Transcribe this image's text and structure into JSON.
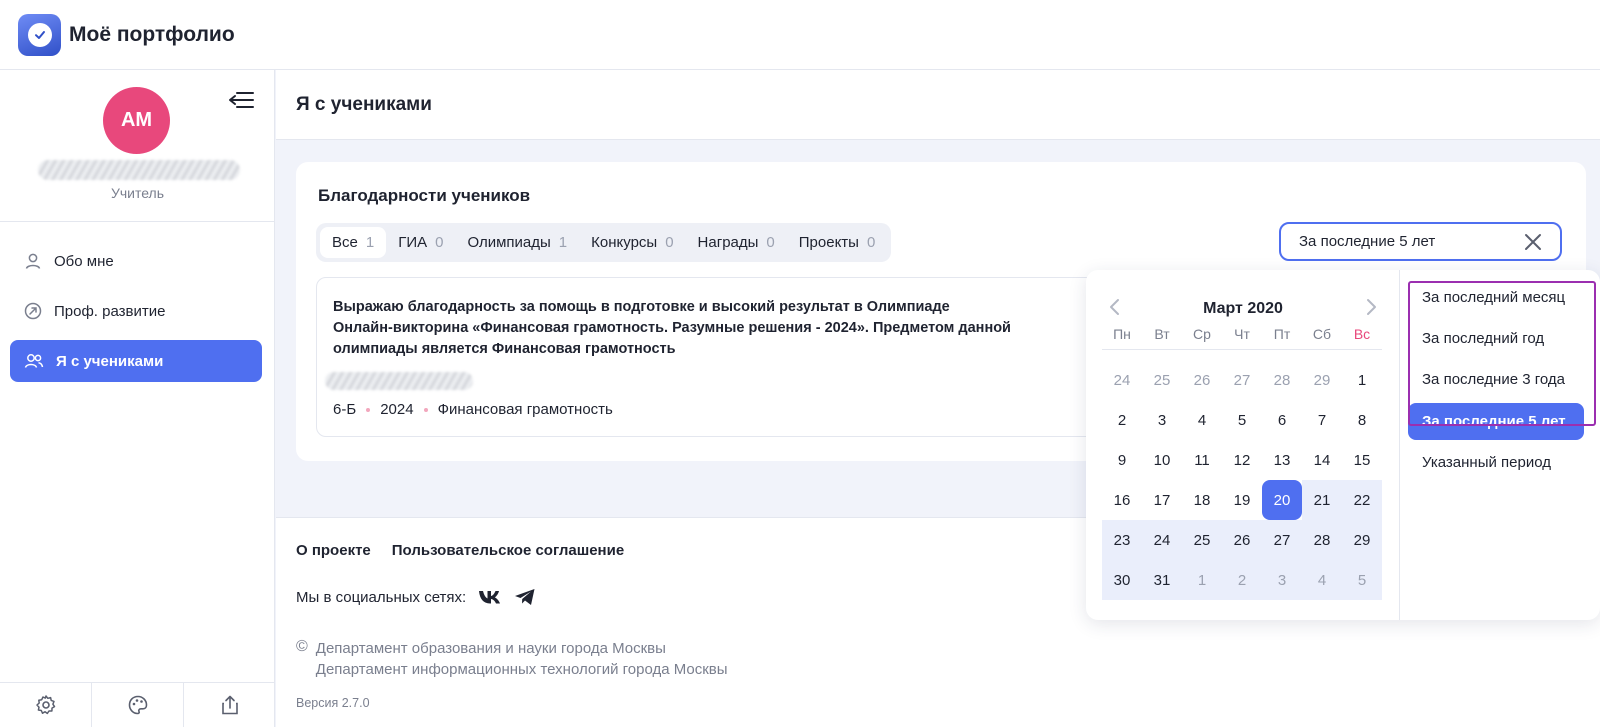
{
  "app": {
    "title": "Моё портфолио",
    "logo_icon": "check-badge-icon"
  },
  "sidebar": {
    "avatar_initials": "АМ",
    "role": "Учитель",
    "nav": [
      {
        "label": "Обо мне",
        "icon": "user-icon"
      },
      {
        "label": "Проф. развитие",
        "icon": "growth-icon"
      },
      {
        "label": "Я с учениками",
        "icon": "users-icon",
        "active": true
      }
    ],
    "bottom_icons": [
      "gear-icon",
      "palette-icon",
      "share-icon"
    ]
  },
  "page": {
    "title": "Я с учениками"
  },
  "section": {
    "title": "Благодарности учеников",
    "tabs": [
      {
        "label": "Все",
        "count": "1",
        "active": true
      },
      {
        "label": "ГИА",
        "count": "0"
      },
      {
        "label": "Олимпиады",
        "count": "1"
      },
      {
        "label": "Конкурсы",
        "count": "0"
      },
      {
        "label": "Награды",
        "count": "0"
      },
      {
        "label": "Проекты",
        "count": "0"
      }
    ],
    "period_value": "За последние 5 лет"
  },
  "gratitude": {
    "text": "Выражаю благодарность за помощь в подготовке и высокий результат в Олимпиаде Онлайн-викторина «Финансовая грамотность. Разумные решения - 2024». Предметом данной олимпиады является Финансовая грамотность",
    "class": "6-Б",
    "year": "2024",
    "subject": "Финансовая грамотность"
  },
  "footer": {
    "about": "О проекте",
    "agreement": "Пользовательское соглашение",
    "social_label": "Мы в социальных сетях:",
    "social_icons": [
      "vk-icon",
      "telegram-icon"
    ],
    "copyright_symbol": "©",
    "org1": "Департамент образования и науки города Москвы",
    "org2": "Департамент информационных технологий города Москвы",
    "version": "Версия 2.7.0"
  },
  "calendar": {
    "month": "Март 2020",
    "weekdays": [
      "Пн",
      "Вт",
      "Ср",
      "Чт",
      "Пт",
      "Сб",
      "Вс"
    ],
    "days": [
      {
        "d": "24",
        "other": true
      },
      {
        "d": "25",
        "other": true
      },
      {
        "d": "26",
        "other": true
      },
      {
        "d": "27",
        "other": true
      },
      {
        "d": "28",
        "other": true
      },
      {
        "d": "29",
        "other": true
      },
      {
        "d": "1"
      },
      {
        "d": "2"
      },
      {
        "d": "3"
      },
      {
        "d": "4"
      },
      {
        "d": "5"
      },
      {
        "d": "6"
      },
      {
        "d": "7"
      },
      {
        "d": "8"
      },
      {
        "d": "9"
      },
      {
        "d": "10"
      },
      {
        "d": "11"
      },
      {
        "d": "12"
      },
      {
        "d": "13"
      },
      {
        "d": "14"
      },
      {
        "d": "15"
      },
      {
        "d": "16"
      },
      {
        "d": "17"
      },
      {
        "d": "18"
      },
      {
        "d": "19"
      },
      {
        "d": "20",
        "selected": true
      },
      {
        "d": "21",
        "range": true
      },
      {
        "d": "22",
        "range": true
      },
      {
        "d": "23",
        "range": true
      },
      {
        "d": "24",
        "range": true
      },
      {
        "d": "25",
        "range": true
      },
      {
        "d": "26",
        "range": true
      },
      {
        "d": "27",
        "range": true
      },
      {
        "d": "28",
        "range": true
      },
      {
        "d": "29",
        "range": true
      },
      {
        "d": "30",
        "range": true
      },
      {
        "d": "31",
        "range": true
      },
      {
        "d": "1",
        "other": true,
        "range": true
      },
      {
        "d": "2",
        "other": true,
        "range": true
      },
      {
        "d": "3",
        "other": true,
        "range": true
      },
      {
        "d": "4",
        "other": true,
        "range": true
      },
      {
        "d": "5",
        "other": true,
        "range": true
      }
    ]
  },
  "period_options": [
    {
      "label": "За последний месяц"
    },
    {
      "label": "За последний год"
    },
    {
      "label": "За последние 3 года"
    },
    {
      "label": "За последние 5 лет",
      "active": true
    },
    {
      "label": "Указанный период"
    }
  ],
  "colors": {
    "accent": "#4f6ff0",
    "avatar": "#e8487c",
    "highlight": "#9b2fb0"
  }
}
